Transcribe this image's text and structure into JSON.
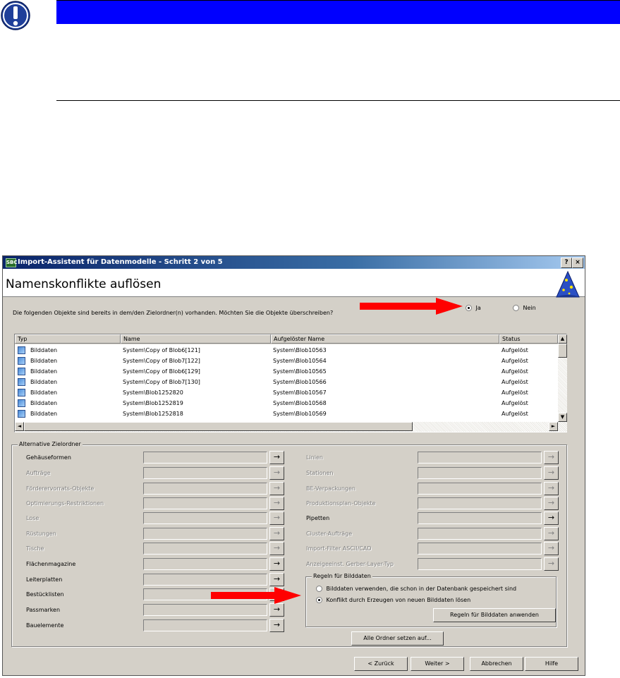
{
  "window": {
    "title": "Import-Assistent für Datenmodelle - Schritt 2 von 5",
    "app_icon_text": "SBC",
    "help_button": "?",
    "close_button": "×",
    "heading": "Namenskonflikte auflösen"
  },
  "overwrite": {
    "question": "Die folgenden Objekte sind bereits in dem/den Zielordner(n) vorhanden. Möchten Sie die Objekte überschreiben?",
    "yes_label": "Ja",
    "no_label": "Nein",
    "selected": "Ja"
  },
  "conflicts": {
    "columns": [
      "Typ",
      "Name",
      "Aufgelöster Name",
      "Status"
    ],
    "rows": [
      {
        "type": "Bilddaten",
        "name": "System\\Copy of Blob6[121]",
        "resolved": "System\\Blob10563",
        "status": "Aufgelöst"
      },
      {
        "type": "Bilddaten",
        "name": "System\\Copy of Blob7[122]",
        "resolved": "System\\Blob10564",
        "status": "Aufgelöst"
      },
      {
        "type": "Bilddaten",
        "name": "System\\Copy of Blob6[129]",
        "resolved": "System\\Blob10565",
        "status": "Aufgelöst"
      },
      {
        "type": "Bilddaten",
        "name": "System\\Copy of Blob7[130]",
        "resolved": "System\\Blob10566",
        "status": "Aufgelöst"
      },
      {
        "type": "Bilddaten",
        "name": "System\\Blob1252820",
        "resolved": "System\\Blob10567",
        "status": "Aufgelöst"
      },
      {
        "type": "Bilddaten",
        "name": "System\\Blob1252819",
        "resolved": "System\\Blob10568",
        "status": "Aufgelöst"
      },
      {
        "type": "Bilddaten",
        "name": "System\\Blob1252818",
        "resolved": "System\\Blob10569",
        "status": "Aufgelöst"
      }
    ]
  },
  "alt_folders": {
    "label": "Alternative Zielordner",
    "left": [
      {
        "label": "Gehäuseformen",
        "enabled": true
      },
      {
        "label": "Aufträge",
        "enabled": false
      },
      {
        "label": "Förderervorrats-Objekte",
        "enabled": false
      },
      {
        "label": "Optimierungs-Restriktionen",
        "enabled": false
      },
      {
        "label": "Lose",
        "enabled": false
      },
      {
        "label": "Rüstungen",
        "enabled": false
      },
      {
        "label": "Tische",
        "enabled": false
      },
      {
        "label": "Flächenmagazine",
        "enabled": true
      },
      {
        "label": "Leiterplatten",
        "enabled": true
      },
      {
        "label": "Bestücklisten",
        "enabled": true
      },
      {
        "label": "Passmarken",
        "enabled": true
      },
      {
        "label": "Bauelemente",
        "enabled": true
      }
    ],
    "right": [
      {
        "label": "Linien",
        "enabled": false
      },
      {
        "label": "Stationen",
        "enabled": false
      },
      {
        "label": "BE-Verpackungen",
        "enabled": false
      },
      {
        "label": "Produktionsplan-Objekte",
        "enabled": false
      },
      {
        "label": "Pipetten",
        "enabled": true
      },
      {
        "label": "Cluster-Aufträge",
        "enabled": false
      },
      {
        "label": "Import-Filter ASCII/CAD",
        "enabled": false
      },
      {
        "label": "Anzeigeeinst. Gerber-Layer-Typ",
        "enabled": false
      }
    ],
    "arrow_glyph": "→"
  },
  "image_rules": {
    "label": "Regeln für Bilddaten",
    "option_use": "Bilddaten verwenden, die schon in der Datenbank gespeichert sind",
    "option_create": "Konflikt durch Erzeugen von neuen Bilddaten lösen",
    "selected": "create",
    "apply_button": "Regeln für Bilddaten anwenden"
  },
  "set_all_button": "Alle Ordner setzen auf...",
  "footer": {
    "back": "< Zurück",
    "next": "Weiter >",
    "cancel": "Abbrechen",
    "help": "Hilfe"
  },
  "colors": {
    "note_bar": "#0000ff",
    "title_bar": "#0a246a",
    "dialog_bg": "#d4d0c8",
    "callout_arrow": "#ff0000"
  }
}
